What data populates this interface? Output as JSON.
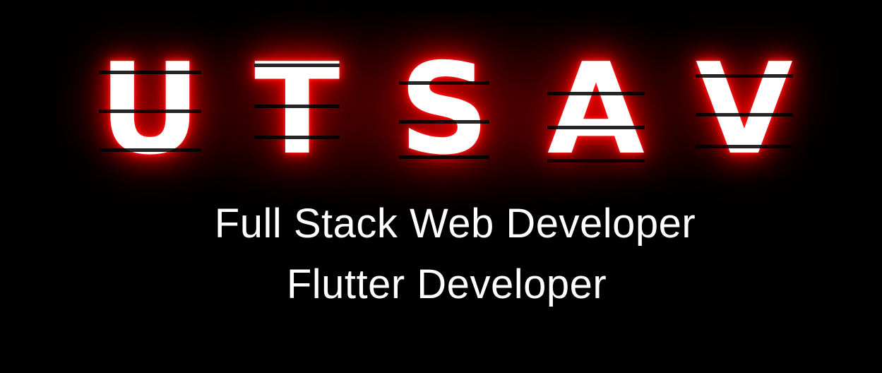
{
  "logo": {
    "letters": [
      "U",
      "T",
      "S",
      "A",
      "V"
    ],
    "glow_color": "#ff0000",
    "text_color": "#ffffff"
  },
  "roles": [
    "Full Stack Web Developer",
    "Flutter Developer"
  ],
  "background_color": "#000000"
}
